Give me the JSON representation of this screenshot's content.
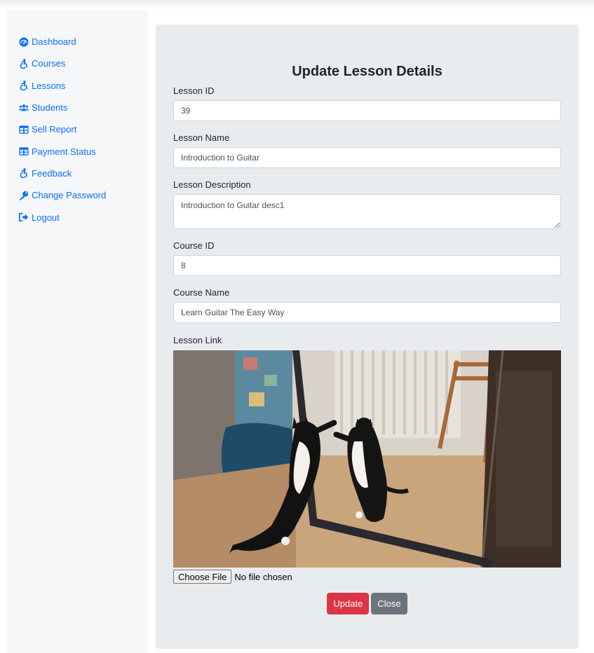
{
  "colors": {
    "link": "#0d6efd",
    "danger": "#dc3545",
    "secondary": "#6c757d",
    "panel": "#e9ecef"
  },
  "sidebar": {
    "items": [
      {
        "label": "Dashboard",
        "icon": "tachometer-icon"
      },
      {
        "label": "Courses",
        "icon": "accessible-icon"
      },
      {
        "label": "Lessons",
        "icon": "accessible-icon"
      },
      {
        "label": "Students",
        "icon": "users-icon"
      },
      {
        "label": "Sell Report",
        "icon": "table-icon"
      },
      {
        "label": "Payment Status",
        "icon": "table-icon"
      },
      {
        "label": "Feedback",
        "icon": "accessible-icon"
      },
      {
        "label": "Change Password",
        "icon": "key-icon"
      },
      {
        "label": "Logout",
        "icon": "sign-out-icon"
      }
    ]
  },
  "form": {
    "title": "Update Lesson Details",
    "lesson_id": {
      "label": "Lesson ID",
      "value": "39"
    },
    "lesson_name": {
      "label": "Lesson Name",
      "value": "Introduction to Guitar"
    },
    "lesson_description": {
      "label": "Lesson Description",
      "value": "Introduction to Guitar desc1"
    },
    "course_id": {
      "label": "Course ID",
      "value": "8"
    },
    "course_name": {
      "label": "Course Name",
      "value": "Learn Guitar The Easy Way"
    },
    "lesson_link": {
      "label": "Lesson Link"
    },
    "file": {
      "button_label": "Choose File",
      "status": "No file chosen"
    },
    "update_label": "Update",
    "close_label": "Close"
  }
}
